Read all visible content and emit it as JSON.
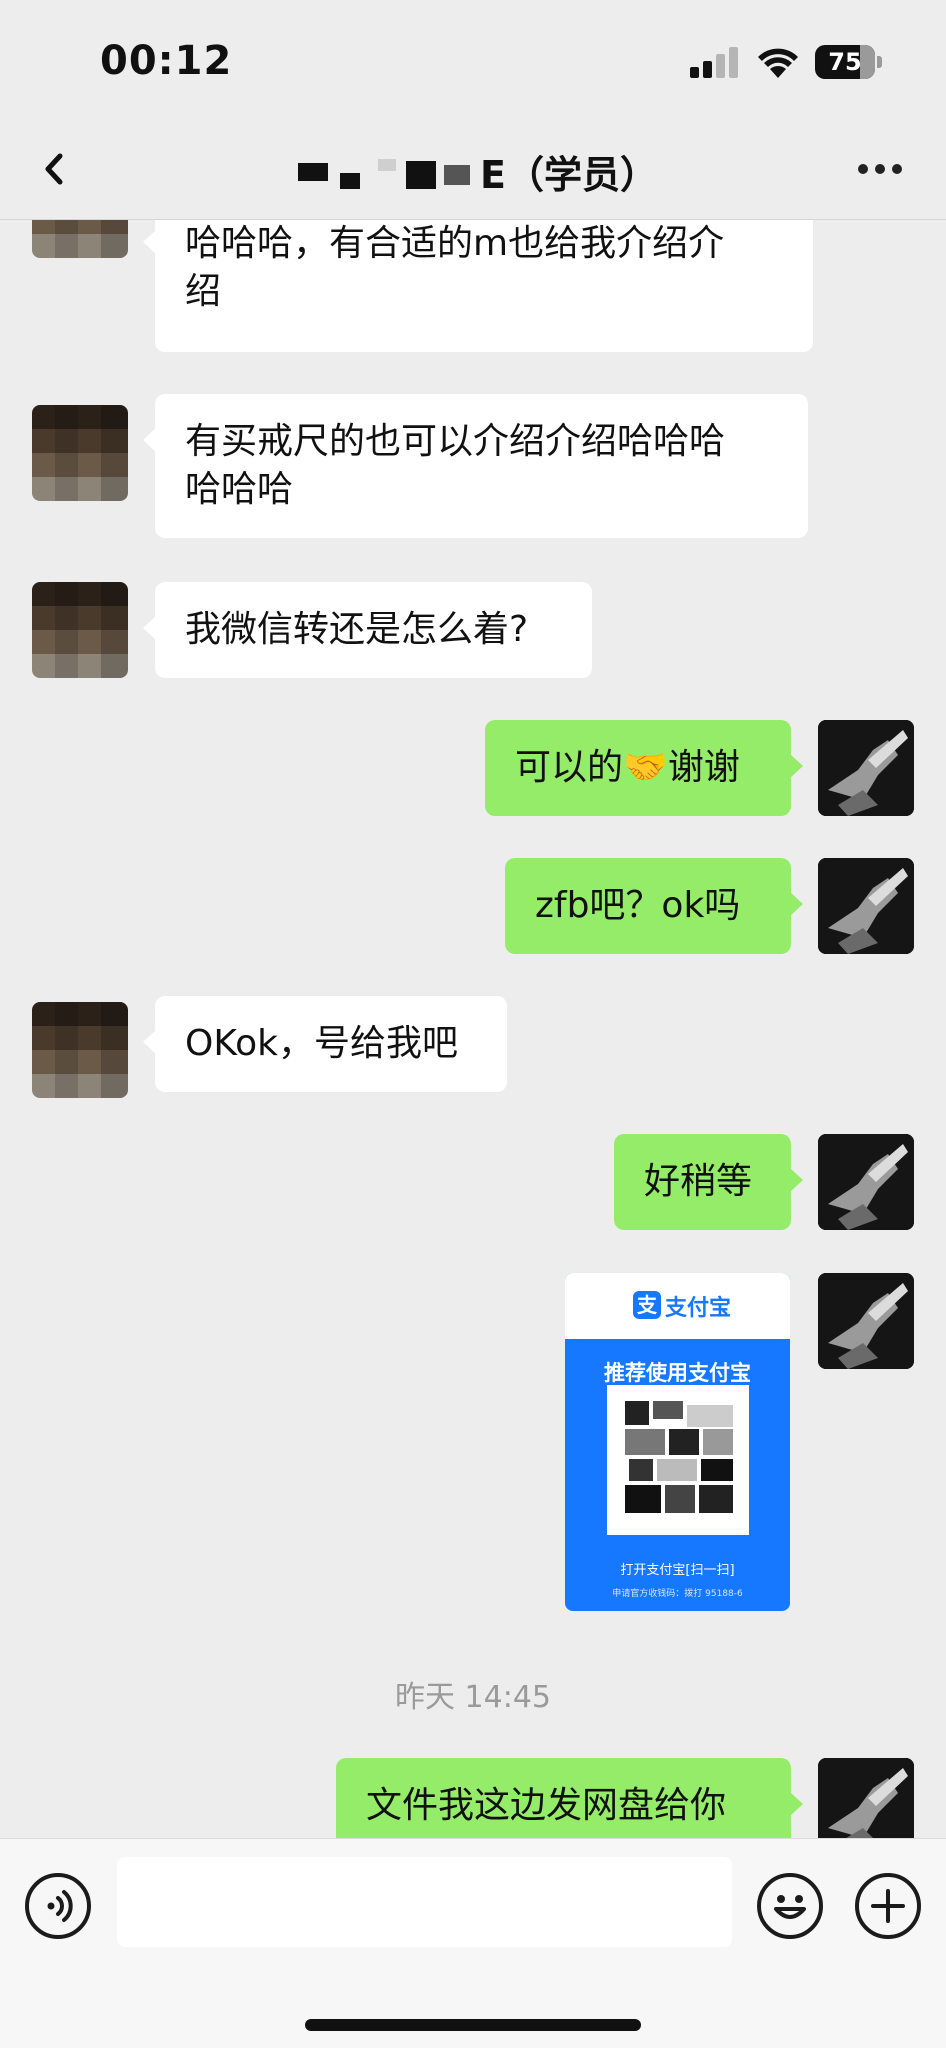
{
  "status_bar": {
    "time": "00:12",
    "battery_percent": "75",
    "battery_level": 0.75
  },
  "nav": {
    "title_suffix": "E（学员）",
    "back_icon": "chevron-left-icon",
    "more_icon": "more-dots-icon"
  },
  "messages": [
    {
      "side": "them",
      "text": "哈哈哈，有合适的m也给我介绍介\n绍"
    },
    {
      "side": "them",
      "text": "有买戒尺的也可以介绍介绍哈哈哈\n哈哈哈"
    },
    {
      "side": "them",
      "text": "我微信转还是怎么着?"
    },
    {
      "side": "me",
      "text": "可以的🤝谢谢"
    },
    {
      "side": "me",
      "text": "zfb吧？ok吗"
    },
    {
      "side": "them",
      "text": "OKok，号给我吧"
    },
    {
      "side": "me",
      "text": "好稍等"
    },
    {
      "side": "me",
      "text": "文件我这边发网盘给你"
    }
  ],
  "alipay_card": {
    "brand": "支付宝",
    "logo_char": "支",
    "slogan": "推荐使用支付宝",
    "scan_text": "打开支付宝[扫一扫]",
    "apply_text": "申请官方收钱码：拨打 95188-6",
    "accent_color": "#1677ff"
  },
  "timestamp": "昨天 14:45",
  "input_bar": {
    "voice_icon": "voice-icon",
    "emoji_icon": "emoji-icon",
    "plus_icon": "plus-icon"
  },
  "colors": {
    "background": "#ededed",
    "bubble_me": "#95ec69",
    "bubble_them": "#ffffff"
  }
}
